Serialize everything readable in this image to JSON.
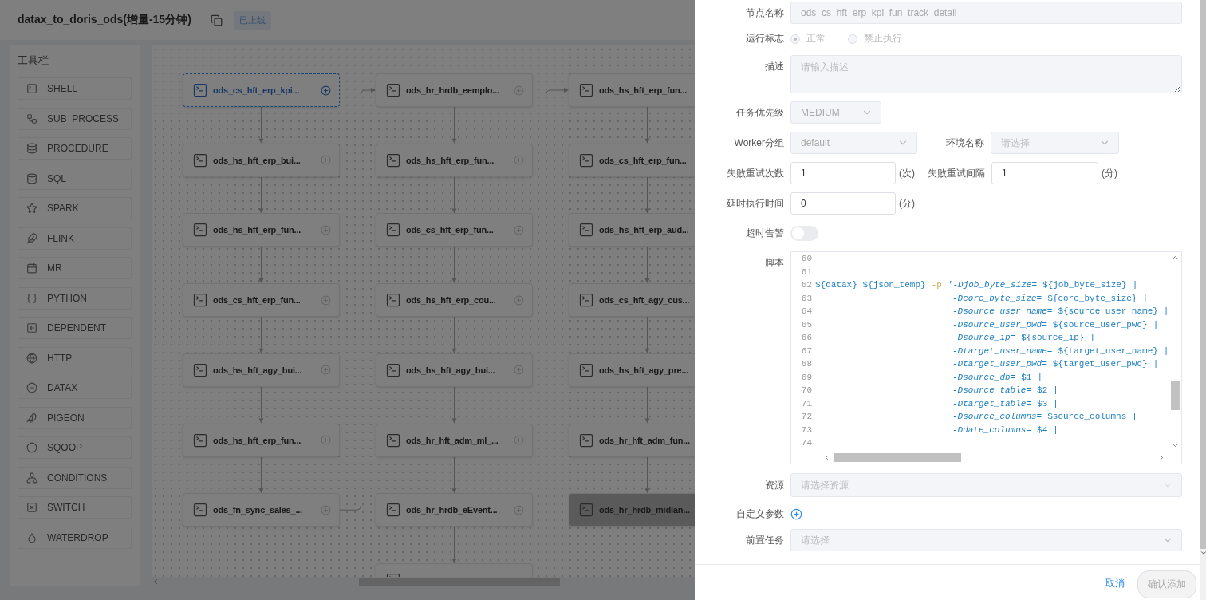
{
  "header": {
    "title": "datax_to_doris_ods(增量-15分钟)",
    "status_tag": "已上线"
  },
  "toolbar": {
    "title": "工具栏",
    "items": [
      {
        "label": "SHELL"
      },
      {
        "label": "SUB_PROCESS"
      },
      {
        "label": "PROCEDURE"
      },
      {
        "label": "SQL"
      },
      {
        "label": "SPARK"
      },
      {
        "label": "FLINK"
      },
      {
        "label": "MR"
      },
      {
        "label": "PYTHON"
      },
      {
        "label": "DEPENDENT"
      },
      {
        "label": "HTTP"
      },
      {
        "label": "DATAX"
      },
      {
        "label": "PIGEON"
      },
      {
        "label": "SQOOP"
      },
      {
        "label": "CONDITIONS"
      },
      {
        "label": "SWITCH"
      },
      {
        "label": "WATERDROP"
      }
    ]
  },
  "canvas": {
    "columns": [
      {
        "nodes": [
          {
            "label": "ods_cs_hft_erp_kpi...",
            "selected": true,
            "disabled": false
          },
          {
            "label": "ods_hs_hft_erp_bui...",
            "selected": false,
            "disabled": false
          },
          {
            "label": "ods_hs_hft_erp_fun...",
            "selected": false,
            "disabled": false
          },
          {
            "label": "ods_cs_hft_erp_fun...",
            "selected": false,
            "disabled": false
          },
          {
            "label": "ods_hs_hft_agy_bui...",
            "selected": false,
            "disabled": false
          },
          {
            "label": "ods_hs_hft_erp_fun...",
            "selected": false,
            "disabled": false
          },
          {
            "label": "ods_fn_sync_sales_...",
            "selected": false,
            "disabled": false
          }
        ]
      },
      {
        "nodes": [
          {
            "label": "ods_hr_hrdb_eemplo...",
            "selected": false,
            "disabled": false
          },
          {
            "label": "ods_hs_hft_erp_fun...",
            "selected": false,
            "disabled": false
          },
          {
            "label": "ods_cs_hft_erp_fun...",
            "selected": false,
            "disabled": false
          },
          {
            "label": "ods_hs_hft_erp_cou...",
            "selected": false,
            "disabled": false
          },
          {
            "label": "ods_hs_hft_agy_bui...",
            "selected": false,
            "disabled": false
          },
          {
            "label": "ods_hr_hft_adm_ml_...",
            "selected": false,
            "disabled": false
          },
          {
            "label": "ods_hr_hrdb_eEvent...",
            "selected": false,
            "disabled": false
          },
          {
            "selected": false,
            "disabled": false
          }
        ]
      },
      {
        "nodes": [
          {
            "label": "ods_hs_hft_erp_fun...",
            "selected": false,
            "disabled": false
          },
          {
            "label": "ods_cs_hft_erp_fun...",
            "selected": false,
            "disabled": false
          },
          {
            "label": "ods_hs_hft_erp_aud...",
            "selected": false,
            "disabled": false
          },
          {
            "label": "ods_cs_hft_agy_cus...",
            "selected": false,
            "disabled": false
          },
          {
            "label": "ods_hs_hft_agy_pre...",
            "selected": false,
            "disabled": false
          },
          {
            "label": "ods_hr_hft_adm_fun...",
            "selected": false,
            "disabled": false
          },
          {
            "label": "ods_hr_hrdb_midlan...",
            "selected": false,
            "disabled": true
          }
        ]
      }
    ]
  },
  "form": {
    "node_name": {
      "label": "节点名称",
      "value": "ods_cs_hft_erp_kpi_fun_track_detail"
    },
    "run_flag": {
      "label": "运行标志",
      "options": [
        {
          "label": "正常",
          "selected": true
        },
        {
          "label": "禁止执行",
          "selected": false
        }
      ]
    },
    "description": {
      "label": "描述",
      "placeholder": "请输入描述"
    },
    "priority": {
      "label": "任务优先级",
      "value": "MEDIUM"
    },
    "worker_group": {
      "label": "Worker分组",
      "value": "default"
    },
    "environment": {
      "label": "环境名称",
      "placeholder": "请选择"
    },
    "retry_times": {
      "label": "失败重试次数",
      "value": "1",
      "unit": "(次)"
    },
    "retry_interval": {
      "label": "失败重试间隔",
      "value": "1",
      "unit": "(分)"
    },
    "delay_time": {
      "label": "延时执行时间",
      "value": "0",
      "unit": "(分)"
    },
    "timeout_alarm": {
      "label": "超时告警",
      "on": false
    },
    "script": {
      "label": "脚本",
      "lines": [
        {
          "number": "60"
        },
        {
          "number": "61"
        },
        {
          "number": "62",
          "indented": false,
          "tokens": [
            {
              "kind": "var",
              "text": "${datax} ${json_temp}"
            },
            {
              "kind": "flag",
              "text": "-p"
            },
            {
              "kind": "param",
              "text": "'-Djob_byte_size="
            },
            {
              "kind": "var",
              "text": "${job_byte_size}"
            },
            {
              "kind": "var",
              "text": "|"
            }
          ]
        },
        {
          "number": "63",
          "indented": true,
          "tokens": [
            {
              "kind": "param",
              "text": "-Dcore_byte_size="
            },
            {
              "kind": "var",
              "text": "${core_byte_size}"
            },
            {
              "kind": "var",
              "text": "|"
            }
          ]
        },
        {
          "number": "64",
          "indented": true,
          "tokens": [
            {
              "kind": "param",
              "text": "-Dsource_user_name="
            },
            {
              "kind": "var",
              "text": "${source_user_name}"
            },
            {
              "kind": "var",
              "text": "|"
            }
          ]
        },
        {
          "number": "65",
          "indented": true,
          "tokens": [
            {
              "kind": "param",
              "text": "-Dsource_user_pwd="
            },
            {
              "kind": "var",
              "text": "${source_user_pwd}"
            },
            {
              "kind": "var",
              "text": "|"
            }
          ]
        },
        {
          "number": "66",
          "indented": true,
          "tokens": [
            {
              "kind": "param",
              "text": "-Dsource_ip="
            },
            {
              "kind": "var",
              "text": "${source_ip}"
            },
            {
              "kind": "var",
              "text": "|"
            }
          ]
        },
        {
          "number": "67",
          "indented": true,
          "tokens": [
            {
              "kind": "param",
              "text": "-Dtarget_user_name="
            },
            {
              "kind": "var",
              "text": "${target_user_name}"
            },
            {
              "kind": "var",
              "text": "|"
            }
          ]
        },
        {
          "number": "68",
          "indented": true,
          "tokens": [
            {
              "kind": "param",
              "text": "-Dtarget_user_pwd="
            },
            {
              "kind": "var",
              "text": "${target_user_pwd}"
            },
            {
              "kind": "var",
              "text": "|"
            }
          ]
        },
        {
          "number": "69",
          "indented": true,
          "tokens": [
            {
              "kind": "param",
              "text": "-Dsource_db="
            },
            {
              "kind": "var",
              "text": "$1"
            },
            {
              "kind": "var",
              "text": "|"
            }
          ]
        },
        {
          "number": "70",
          "indented": true,
          "tokens": [
            {
              "kind": "param",
              "text": "-Dsource_table="
            },
            {
              "kind": "var",
              "text": "$2"
            },
            {
              "kind": "var",
              "text": "|"
            }
          ]
        },
        {
          "number": "71",
          "indented": true,
          "tokens": [
            {
              "kind": "param",
              "text": "-Dtarget_table="
            },
            {
              "kind": "var",
              "text": "$3"
            },
            {
              "kind": "var",
              "text": "|"
            }
          ]
        },
        {
          "number": "72",
          "indented": true,
          "tokens": [
            {
              "kind": "param",
              "text": "-Dsource_columns="
            },
            {
              "kind": "var",
              "text": "$source_columns"
            },
            {
              "kind": "var",
              "text": "|"
            }
          ]
        },
        {
          "number": "73",
          "indented": true,
          "tokens": [
            {
              "kind": "param",
              "text": "-Ddate_columns="
            },
            {
              "kind": "var",
              "text": "$4"
            },
            {
              "kind": "var",
              "text": "|"
            }
          ]
        },
        {
          "number": "74"
        }
      ]
    },
    "resource": {
      "label": "资源",
      "placeholder": "请选择资源"
    },
    "custom_params": {
      "label": "自定义参数"
    },
    "pre_tasks": {
      "label": "前置任务",
      "placeholder": "请选择"
    }
  },
  "footer": {
    "cancel": "取消",
    "confirm": {
      "label": "确认添加",
      "disabled": true
    }
  }
}
